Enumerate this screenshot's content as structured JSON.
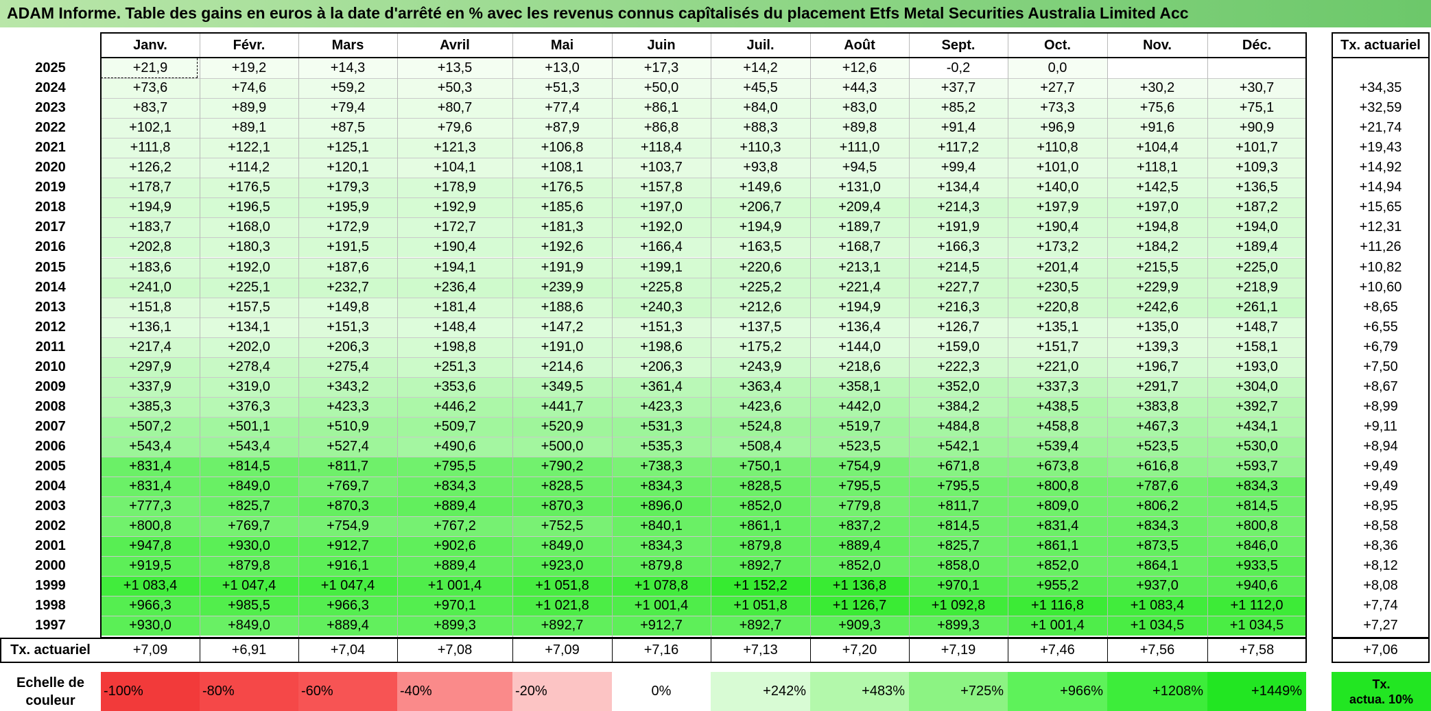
{
  "title": "ADAM Informe. Table des gains en euros à la date d'arrêté en % avec les revenus connus capîtalisés du placement Etfs Metal Securities Australia Limited Acc",
  "colors": {
    "title_bar_start": "#b9e6a9",
    "title_bar_end": "#6cc86a",
    "negative_scale": [
      "#f23a3a",
      "#f54848",
      "#f75454",
      "#fa8a8a",
      "#fcc4c4"
    ],
    "zero": "#ffffff",
    "positive_scale": [
      "#d8fbd4",
      "#b3f8ab",
      "#8cf383",
      "#5ef25a",
      "#3ded3a",
      "#22e622"
    ]
  },
  "chart_data": {
    "type": "table",
    "months": [
      "Janv.",
      "Févr.",
      "Mars",
      "Avril",
      "Mai",
      "Juin",
      "Juil.",
      "Août",
      "Sept.",
      "Oct.",
      "Nov.",
      "Déc."
    ],
    "tx_header": "Tx. actuariel",
    "rows": [
      {
        "year": "2025",
        "values": [
          "+21,9",
          "+19,2",
          "+14,3",
          "+13,5",
          "+13,0",
          "+17,3",
          "+14,2",
          "+12,6",
          "-0,2",
          "0,0",
          "",
          ""
        ],
        "tx": ""
      },
      {
        "year": "2024",
        "values": [
          "+73,6",
          "+74,6",
          "+59,2",
          "+50,3",
          "+51,3",
          "+50,0",
          "+45,5",
          "+44,3",
          "+37,7",
          "+27,7",
          "+30,2",
          "+30,7"
        ],
        "tx": "+34,35"
      },
      {
        "year": "2023",
        "values": [
          "+83,7",
          "+89,9",
          "+79,4",
          "+80,7",
          "+77,4",
          "+86,1",
          "+84,0",
          "+83,0",
          "+85,2",
          "+73,3",
          "+75,6",
          "+75,1"
        ],
        "tx": "+32,59"
      },
      {
        "year": "2022",
        "values": [
          "+102,1",
          "+89,1",
          "+87,5",
          "+79,6",
          "+87,9",
          "+86,8",
          "+88,3",
          "+89,8",
          "+91,4",
          "+96,9",
          "+91,6",
          "+90,9"
        ],
        "tx": "+21,74"
      },
      {
        "year": "2021",
        "values": [
          "+111,8",
          "+122,1",
          "+125,1",
          "+121,3",
          "+106,8",
          "+118,4",
          "+110,3",
          "+111,0",
          "+117,2",
          "+110,8",
          "+104,4",
          "+101,7"
        ],
        "tx": "+19,43"
      },
      {
        "year": "2020",
        "values": [
          "+126,2",
          "+114,2",
          "+120,1",
          "+104,1",
          "+108,1",
          "+103,7",
          "+93,8",
          "+94,5",
          "+99,4",
          "+101,0",
          "+118,1",
          "+109,3"
        ],
        "tx": "+14,92"
      },
      {
        "year": "2019",
        "values": [
          "+178,7",
          "+176,5",
          "+179,3",
          "+178,9",
          "+176,5",
          "+157,8",
          "+149,6",
          "+131,0",
          "+134,4",
          "+140,0",
          "+142,5",
          "+136,5"
        ],
        "tx": "+14,94"
      },
      {
        "year": "2018",
        "values": [
          "+194,9",
          "+196,5",
          "+195,9",
          "+192,9",
          "+185,6",
          "+197,0",
          "+206,7",
          "+209,4",
          "+214,3",
          "+197,9",
          "+197,0",
          "+187,2"
        ],
        "tx": "+15,65"
      },
      {
        "year": "2017",
        "values": [
          "+183,7",
          "+168,0",
          "+172,9",
          "+172,7",
          "+181,3",
          "+192,0",
          "+194,9",
          "+189,7",
          "+191,9",
          "+190,4",
          "+194,8",
          "+194,0"
        ],
        "tx": "+12,31"
      },
      {
        "year": "2016",
        "values": [
          "+202,8",
          "+180,3",
          "+191,5",
          "+190,4",
          "+192,6",
          "+166,4",
          "+163,5",
          "+168,7",
          "+166,3",
          "+173,2",
          "+184,2",
          "+189,4"
        ],
        "tx": "+11,26"
      },
      {
        "year": "2015",
        "values": [
          "+183,6",
          "+192,0",
          "+187,6",
          "+194,1",
          "+191,9",
          "+199,1",
          "+220,6",
          "+213,1",
          "+214,5",
          "+201,4",
          "+215,5",
          "+225,0"
        ],
        "tx": "+10,82"
      },
      {
        "year": "2014",
        "values": [
          "+241,0",
          "+225,1",
          "+232,7",
          "+236,4",
          "+239,9",
          "+225,8",
          "+225,2",
          "+221,4",
          "+227,7",
          "+230,5",
          "+229,9",
          "+218,9"
        ],
        "tx": "+10,60"
      },
      {
        "year": "2013",
        "values": [
          "+151,8",
          "+157,5",
          "+149,8",
          "+181,4",
          "+188,6",
          "+240,3",
          "+212,6",
          "+194,9",
          "+216,3",
          "+220,8",
          "+242,6",
          "+261,1"
        ],
        "tx": "+8,65"
      },
      {
        "year": "2012",
        "values": [
          "+136,1",
          "+134,1",
          "+151,3",
          "+148,4",
          "+147,2",
          "+151,3",
          "+137,5",
          "+136,4",
          "+126,7",
          "+135,1",
          "+135,0",
          "+148,7"
        ],
        "tx": "+6,55"
      },
      {
        "year": "2011",
        "values": [
          "+217,4",
          "+202,0",
          "+206,3",
          "+198,8",
          "+191,0",
          "+198,6",
          "+175,2",
          "+144,0",
          "+159,0",
          "+151,7",
          "+139,3",
          "+158,1"
        ],
        "tx": "+6,79"
      },
      {
        "year": "2010",
        "values": [
          "+297,9",
          "+278,4",
          "+275,4",
          "+251,3",
          "+214,6",
          "+206,3",
          "+243,9",
          "+218,6",
          "+222,3",
          "+221,0",
          "+196,7",
          "+193,0"
        ],
        "tx": "+7,50"
      },
      {
        "year": "2009",
        "values": [
          "+337,9",
          "+319,0",
          "+343,2",
          "+353,6",
          "+349,5",
          "+361,4",
          "+363,4",
          "+358,1",
          "+352,0",
          "+337,3",
          "+291,7",
          "+304,0"
        ],
        "tx": "+8,67"
      },
      {
        "year": "2008",
        "values": [
          "+385,3",
          "+376,3",
          "+423,3",
          "+446,2",
          "+441,7",
          "+423,3",
          "+423,6",
          "+442,0",
          "+384,2",
          "+438,5",
          "+383,8",
          "+392,7"
        ],
        "tx": "+8,99"
      },
      {
        "year": "2007",
        "values": [
          "+507,2",
          "+501,1",
          "+510,9",
          "+509,7",
          "+520,9",
          "+531,3",
          "+524,8",
          "+519,7",
          "+484,8",
          "+458,8",
          "+467,3",
          "+434,1"
        ],
        "tx": "+9,11"
      },
      {
        "year": "2006",
        "values": [
          "+543,4",
          "+543,4",
          "+527,4",
          "+490,6",
          "+500,0",
          "+535,3",
          "+508,4",
          "+523,5",
          "+542,1",
          "+539,4",
          "+523,5",
          "+530,0"
        ],
        "tx": "+8,94"
      },
      {
        "year": "2005",
        "values": [
          "+831,4",
          "+814,5",
          "+811,7",
          "+795,5",
          "+790,2",
          "+738,3",
          "+750,1",
          "+754,9",
          "+671,8",
          "+673,8",
          "+616,8",
          "+593,7"
        ],
        "tx": "+9,49"
      },
      {
        "year": "2004",
        "values": [
          "+831,4",
          "+849,0",
          "+769,7",
          "+834,3",
          "+828,5",
          "+834,3",
          "+828,5",
          "+795,5",
          "+795,5",
          "+800,8",
          "+787,6",
          "+834,3"
        ],
        "tx": "+9,49"
      },
      {
        "year": "2003",
        "values": [
          "+777,3",
          "+825,7",
          "+870,3",
          "+889,4",
          "+870,3",
          "+896,0",
          "+852,0",
          "+779,8",
          "+811,7",
          "+809,0",
          "+806,2",
          "+814,5"
        ],
        "tx": "+8,95"
      },
      {
        "year": "2002",
        "values": [
          "+800,8",
          "+769,7",
          "+754,9",
          "+767,2",
          "+752,5",
          "+840,1",
          "+861,1",
          "+837,2",
          "+814,5",
          "+831,4",
          "+834,3",
          "+800,8"
        ],
        "tx": "+8,58"
      },
      {
        "year": "2001",
        "values": [
          "+947,8",
          "+930,0",
          "+912,7",
          "+902,6",
          "+849,0",
          "+834,3",
          "+879,8",
          "+889,4",
          "+825,7",
          "+861,1",
          "+873,5",
          "+846,0"
        ],
        "tx": "+8,36"
      },
      {
        "year": "2000",
        "values": [
          "+919,5",
          "+879,8",
          "+916,1",
          "+889,4",
          "+923,0",
          "+879,8",
          "+892,7",
          "+852,0",
          "+858,0",
          "+852,0",
          "+864,1",
          "+933,5"
        ],
        "tx": "+8,12"
      },
      {
        "year": "1999",
        "values": [
          "+1 083,4",
          "+1 047,4",
          "+1 047,4",
          "+1 001,4",
          "+1 051,8",
          "+1 078,8",
          "+1 152,2",
          "+1 136,8",
          "+970,1",
          "+955,2",
          "+937,0",
          "+940,6"
        ],
        "tx": "+8,08"
      },
      {
        "year": "1998",
        "values": [
          "+966,3",
          "+985,5",
          "+966,3",
          "+970,1",
          "+1 021,8",
          "+1 001,4",
          "+1 051,8",
          "+1 126,7",
          "+1 092,8",
          "+1 116,8",
          "+1 083,4",
          "+1 112,0"
        ],
        "tx": "+7,74"
      },
      {
        "year": "1997",
        "values": [
          "+930,0",
          "+849,0",
          "+889,4",
          "+899,3",
          "+892,7",
          "+912,7",
          "+892,7",
          "+909,3",
          "+899,3",
          "+1 001,4",
          "+1 034,5",
          "+1 034,5"
        ],
        "tx": "+7,27"
      }
    ],
    "footer": {
      "label": "Tx. actuariel",
      "values": [
        "+7,09",
        "+6,91",
        "+7,04",
        "+7,08",
        "+7,09",
        "+7,16",
        "+7,13",
        "+7,20",
        "+7,19",
        "+7,46",
        "+7,56",
        "+7,58"
      ],
      "tx": "+7,06"
    },
    "scale": {
      "label_line1": "Echelle de",
      "label_line2": "couleur",
      "steps": [
        "-100%",
        "-80%",
        "-60%",
        "-40%",
        "-20%",
        "0%",
        "+242%",
        "+483%",
        "+725%",
        "+966%",
        "+1208%",
        "+1449%"
      ],
      "step_values": [
        -100,
        -80,
        -60,
        -40,
        -20,
        0,
        242,
        483,
        725,
        966,
        1208,
        1449
      ],
      "tx_legend_line1": "Tx.",
      "tx_legend_line2": "actua. 10%"
    }
  }
}
